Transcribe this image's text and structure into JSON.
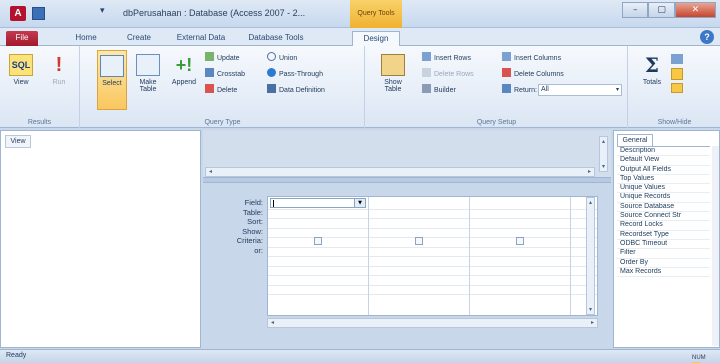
{
  "window": {
    "app_icon": "A",
    "title": "dbPerusahaan : Database (Access 2007 - 2...",
    "context_tab": "Query Tools",
    "minimize_icon": "minimize-icon",
    "maximize_icon": "maximize-icon",
    "close_icon": "close-icon"
  },
  "ribbon_tabs": [
    {
      "label": "File"
    },
    {
      "label": "Home"
    },
    {
      "label": "Create"
    },
    {
      "label": "External Data"
    },
    {
      "label": "Database Tools"
    },
    {
      "label": "Design",
      "active": true
    }
  ],
  "ribbon": {
    "results": {
      "label": "Results",
      "view": "View",
      "run": "Run",
      "sql_badge": "SQL"
    },
    "query_type": {
      "label": "Query Type",
      "select": "Select",
      "make_table": "Make Table",
      "append": "Append",
      "update": "Update",
      "crosstab": "Crosstab",
      "delete": "Delete",
      "union": "Union",
      "pass_through": "Pass-Through",
      "data_definition": "Data Definition"
    },
    "query_setup": {
      "label": "Query Setup",
      "show_table": "Show Table",
      "insert_rows": "Insert Rows",
      "delete_rows": "Delete Rows",
      "builder": "Builder",
      "insert_columns": "Insert Columns",
      "delete_columns": "Delete Columns",
      "return_label": "Return:",
      "return_value": "All"
    },
    "show_hide": {
      "label": "Show/Hide",
      "totals": "Totals"
    }
  },
  "nav_pane": {
    "view_label": "View"
  },
  "query_grid": {
    "row_labels": [
      "Field:",
      "Table:",
      "Sort:",
      "Show:",
      "Criteria:",
      "or:"
    ],
    "columns": 3
  },
  "property_sheet": {
    "tab": "General",
    "items": [
      "Description",
      "Default View",
      "Output All Fields",
      "Top Values",
      "Unique Values",
      "Unique Records",
      "Source Database",
      "Source Connect Str",
      "Record Locks",
      "Recordset Type",
      "ODBC Timeout",
      "Filter",
      "Order By",
      "Max Records"
    ]
  },
  "status": {
    "text": "Ready",
    "num_lock": "NUM"
  }
}
